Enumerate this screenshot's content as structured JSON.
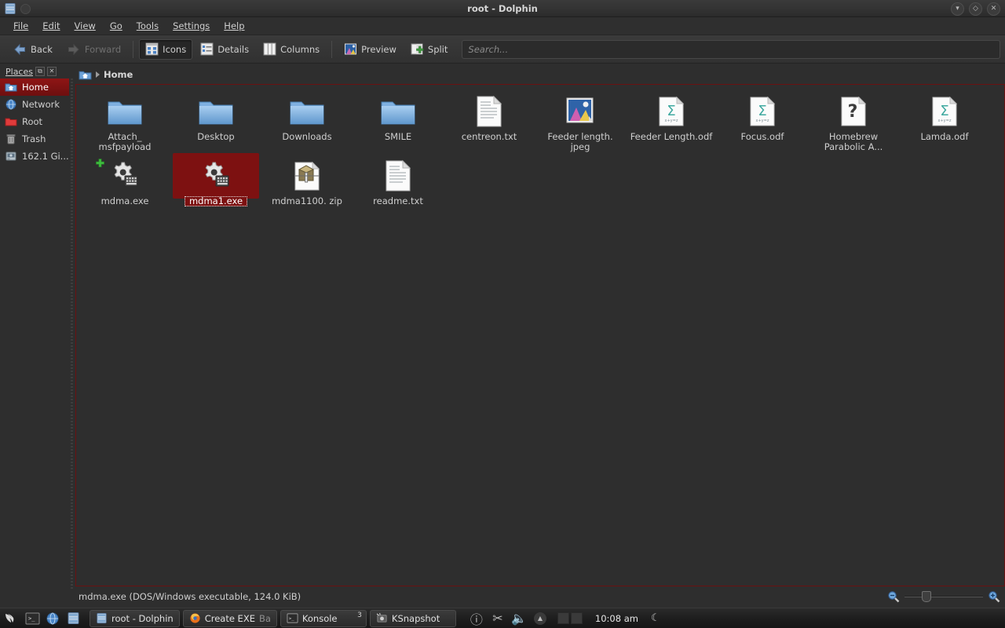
{
  "window": {
    "title": "root - Dolphin",
    "icon": "dolphin-icon",
    "buttons": [
      {
        "name": "minimize-button",
        "glyph": "▾"
      },
      {
        "name": "maximize-button",
        "glyph": "◇"
      },
      {
        "name": "close-button",
        "glyph": "✕"
      }
    ]
  },
  "menubar": {
    "items": [
      {
        "label": "File",
        "accel": "F"
      },
      {
        "label": "Edit",
        "accel": "E"
      },
      {
        "label": "View",
        "accel": "V"
      },
      {
        "label": "Go",
        "accel": "G"
      },
      {
        "label": "Tools",
        "accel": "T"
      },
      {
        "label": "Settings",
        "accel": "S"
      },
      {
        "label": "Help",
        "accel": "H"
      }
    ]
  },
  "toolbar": {
    "back_label": "Back",
    "forward_label": "Forward",
    "icons_label": "Icons",
    "details_label": "Details",
    "columns_label": "Columns",
    "preview_label": "Preview",
    "split_label": "Split",
    "active_view": "Icons",
    "search_placeholder": "Search...",
    "search_value": ""
  },
  "places": {
    "title": "Places",
    "title_accel": "P",
    "items": [
      {
        "label": "Home",
        "icon": "home-folder-icon",
        "selected": true
      },
      {
        "label": "Network",
        "icon": "network-globe-icon",
        "selected": false
      },
      {
        "label": "Root",
        "icon": "red-folder-icon",
        "selected": false
      },
      {
        "label": "Trash",
        "icon": "trash-icon",
        "selected": false
      },
      {
        "label": "162.1 Gi...",
        "icon": "harddisk-icon",
        "selected": false
      }
    ]
  },
  "breadcrumb": {
    "root_icon": "home-folder-icon",
    "path": "Home"
  },
  "files": [
    {
      "name": "Attach_\nmsfpayload",
      "label": "Attach_ msfpayload",
      "type": "folder",
      "selected": false,
      "badge": null
    },
    {
      "name": "Desktop",
      "label": "Desktop",
      "type": "folder",
      "selected": false,
      "badge": null
    },
    {
      "name": "Downloads",
      "label": "Downloads",
      "type": "folder",
      "selected": false,
      "badge": null
    },
    {
      "name": "SMILE",
      "label": "SMILE",
      "type": "folder",
      "selected": false,
      "badge": null
    },
    {
      "name": "centreon.txt",
      "label": "centreon.txt",
      "type": "text",
      "selected": false,
      "badge": null
    },
    {
      "name": "Feeder length.jpeg",
      "label": "Feeder length. jpeg",
      "type": "image",
      "selected": false,
      "badge": null
    },
    {
      "name": "Feeder Length.odf",
      "label": "Feeder Length.odf",
      "type": "formula",
      "selected": false,
      "badge": null
    },
    {
      "name": "Focus.odf",
      "label": "Focus.odf",
      "type": "formula",
      "selected": false,
      "badge": null
    },
    {
      "name": "Homebrew Parabolic A...",
      "label": "Homebrew Parabolic A...",
      "type": "unknown",
      "selected": false,
      "badge": null
    },
    {
      "name": "Lamda.odf",
      "label": "Lamda.odf",
      "type": "formula",
      "selected": false,
      "badge": null
    },
    {
      "name": "mdma.exe",
      "label": "mdma.exe",
      "type": "executable",
      "selected": false,
      "badge": "add-plus-badge"
    },
    {
      "name": "mdma1.exe",
      "label": "mdma1.exe",
      "type": "executable",
      "selected": true,
      "badge": null
    },
    {
      "name": "mdma1100.zip",
      "label": "mdma1100. zip",
      "type": "archive",
      "selected": false,
      "badge": null
    },
    {
      "name": "readme.txt",
      "label": "readme.txt",
      "type": "text",
      "selected": false,
      "badge": null
    }
  ],
  "statusbar": {
    "text": "mdma.exe (DOS/Windows executable, 124.0 KiB)",
    "zoom_out_icon": "zoom-out-icon",
    "zoom_in_icon": "zoom-in-icon"
  },
  "taskbar": {
    "launchers": [
      {
        "name": "kali-menu-icon"
      },
      {
        "name": "terminal-icon"
      },
      {
        "name": "browser-icon"
      },
      {
        "name": "file-manager-icon"
      }
    ],
    "tasks": [
      {
        "label": "root - Dolphin",
        "icon": "dolphin-icon",
        "count": null,
        "dim": false
      },
      {
        "label": "Create EXE",
        "sublabel": "Ba",
        "icon": "firefox-icon",
        "count": null,
        "dim": false
      },
      {
        "label": "Konsole",
        "icon": "konsole-icon",
        "count": "3",
        "dim": false
      },
      {
        "label": "KSnapshot",
        "icon": "ksnapshot-icon",
        "count": null,
        "dim": false
      }
    ],
    "tray": [
      {
        "name": "info-icon",
        "glyph": "ⓘ"
      },
      {
        "name": "scissors-icon",
        "glyph": "✂"
      },
      {
        "name": "volume-icon",
        "glyph": "🔊"
      },
      {
        "name": "update-icon",
        "glyph": "▲"
      }
    ],
    "clock": "10:08 am",
    "moon_icon": "moon-icon"
  },
  "colors": {
    "selection_red": "#7d1111",
    "border_red": "#6b1111",
    "window_bg": "#2e2e2e",
    "text": "#cfcfcf"
  }
}
